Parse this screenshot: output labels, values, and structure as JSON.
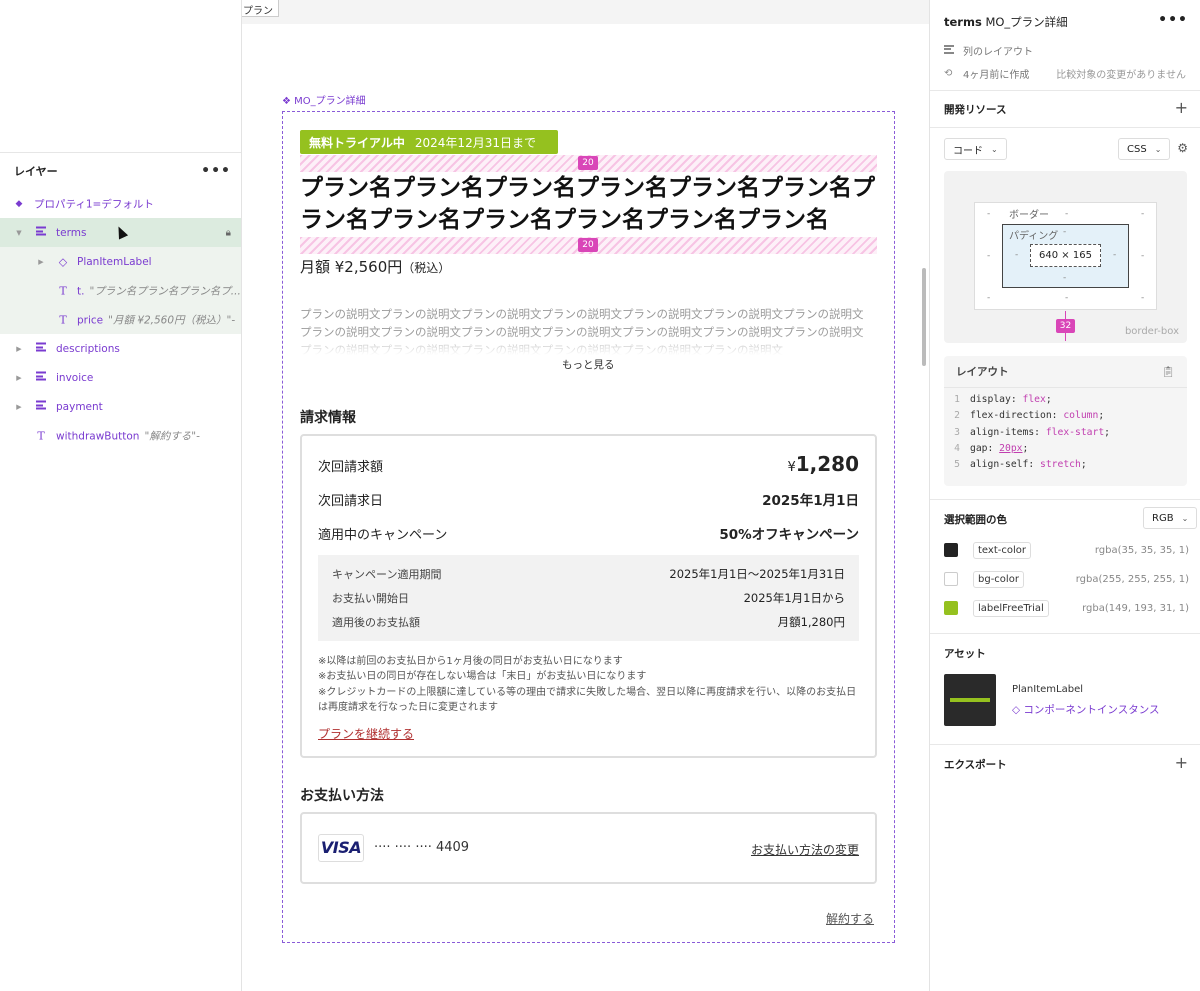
{
  "left_panel": {
    "title": "レイヤー",
    "more": "•••",
    "layers": [
      {
        "name": "プロパティ1=デフォルト",
        "icon": "variant-diamond-icon"
      },
      {
        "name": "terms",
        "icon": "auto-layout-icon"
      },
      {
        "name": "PlanItemLabel",
        "icon": "instance-diamond-icon"
      },
      {
        "name": "t.",
        "sub": "\"プラン名プラン名プラン名プ...",
        "icon": "text-icon"
      },
      {
        "name": "price",
        "sub": "\"月額 ¥2,560円（税込）\"-",
        "icon": "text-icon"
      },
      {
        "name": "descriptions",
        "icon": "auto-layout-icon"
      },
      {
        "name": "invoice",
        "icon": "auto-layout-icon"
      },
      {
        "name": "payment",
        "icon": "auto-layout-icon"
      },
      {
        "name": "withdrawButton",
        "sub": "\"解約する\"-",
        "icon": "text-icon"
      }
    ]
  },
  "canvas": {
    "tab_fragment": "プラン",
    "component_label": "❖ MO_プラン詳細",
    "badge_strong": "無料トライアル中",
    "badge_date": "2024年12月31日まで",
    "gap_top": "20",
    "gap_bottom": "20",
    "plan_name": "プラン名プラン名プラン名プラン名プラン名プラン名プラン名プラン名プラン名プラン名プラン名プラン名",
    "price_main": "月額 ¥2,560円",
    "price_tax": "（税込）",
    "description": "プランの説明文プランの説明文プランの説明文プランの説明文プランの説明文プランの説明文プランの説明文プランの説明文プランの説明文プランの説明文プランの説明文プランの説明文プランの説明文プランの説明文プランの説明文プランの説明文プランの説明文プランの説明文プランの説明文プランの説明文",
    "more_link": "もっと見る",
    "billing": {
      "title": "請求情報",
      "next_amount_label": "次回請求額",
      "next_amount_yen": "¥",
      "next_amount_value": "1,280",
      "next_date_label": "次回請求日",
      "next_date_value": "2025年1月1日",
      "campaign_label": "適用中のキャンペーン",
      "campaign_value": "50%オフキャンペーン",
      "details": [
        {
          "label": "キャンペーン適用期間",
          "value": "2025年1月1日〜2025年1月31日"
        },
        {
          "label": "お支払い開始日",
          "value": "2025年1月1日から"
        },
        {
          "label": "適用後のお支払額",
          "value": "月額1,280円"
        }
      ],
      "notes": [
        "※以降は前回のお支払日から1ヶ月後の同日がお支払い日になります",
        "※お支払い日の同日が存在しない場合は「末日」がお支払い日になります",
        "※クレジットカードの上限額に達している等の理由で請求に失敗した場合、翌日以降に再度請求を行い、以降のお支払日は再度請求を行なった日に変更されます"
      ],
      "continue_link": "プランを継続する"
    },
    "payment": {
      "title": "お支払い方法",
      "brand": "VISA",
      "card_number": "···· ···· ···· 4409",
      "change_link": "お支払い方法の変更"
    },
    "cancel_link": "解約する"
  },
  "right_panel": {
    "title_bold": "terms",
    "title_rest": "MO_プラン詳細",
    "more": "•••",
    "layout_type": "列のレイアウト",
    "created": "4ヶ月前に作成",
    "compare_note": "比較対象の変更がありません",
    "dev_resources": "開発リソース",
    "code_dropdown": "コード",
    "css_dropdown": "CSS",
    "box_model": {
      "border_label": "ボーダー",
      "padding_label": "パディング",
      "content_size": "640 × 165",
      "dash": "-",
      "margin_bottom": "32",
      "note": "border-box"
    },
    "layout_section": "レイアウト",
    "code": [
      {
        "n": "1",
        "prop": "display",
        "val": "flex"
      },
      {
        "n": "2",
        "prop": "flex-direction",
        "val": "column"
      },
      {
        "n": "3",
        "prop": "align-items",
        "val": "flex-start"
      },
      {
        "n": "4",
        "prop": "gap",
        "val": "20px"
      },
      {
        "n": "5",
        "prop": "align-self",
        "val": "stretch"
      }
    ],
    "colors_title": "選択範囲の色",
    "color_mode": "RGB",
    "colors": [
      {
        "name": "text-color",
        "value": "rgba(35, 35, 35, 1)",
        "hex": "#232323"
      },
      {
        "name": "bg-color",
        "value": "rgba(255, 255, 255, 1)",
        "hex": "#ffffff"
      },
      {
        "name": "labelFreeTrial",
        "value": "rgba(149, 193, 31, 1)",
        "hex": "#95c11f"
      }
    ],
    "assets_title": "アセット",
    "asset_name": "PlanItemLabel",
    "asset_type": "◇ コンポーネントインスタンス",
    "export_title": "エクスポート",
    "plus": "+"
  }
}
